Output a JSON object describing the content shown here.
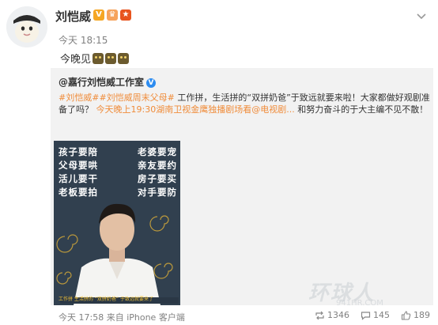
{
  "post": {
    "author": "刘恺威",
    "time": "今天 18:15",
    "text": "今晚见",
    "emoji_icons": [
      "emoji-icon",
      "emoji-icon",
      "emoji-icon"
    ],
    "badge_icons": [
      "verified-icon",
      "level-icon",
      "vip-icon"
    ]
  },
  "repost": {
    "author": "@嘉行刘恺威工作室",
    "tag1": "#刘恺威#",
    "tag2": "#刘恺威周末父母#",
    "text_part1": "工作拼，生活拼的“双拼奶爸”于致远就要来啦！大家都做好观剧准备了吗？",
    "link_text": "今天晚上19:30湖南卫视金鹰独播剧场看@电视剧...",
    "text_part2": "和努力奋斗的于大主编不见不散！",
    "poster_lines": [
      [
        "孩子要陪",
        "老婆要宠"
      ],
      [
        "父母要哄",
        "亲友要约"
      ],
      [
        "活儿要干",
        "房子要买"
      ],
      [
        "老板要拍",
        "对手要防"
      ]
    ],
    "poster_caption": "工作拼  生活拼的  “双拼奶爸”  于致远就要来了"
  },
  "footer": {
    "meta": "今天 17:58 来自 iPhone 客户端",
    "repost_count": "1346",
    "comment_count": "145",
    "like_count": "189"
  },
  "watermark": {
    "main": "环球人",
    "sub": "941HR.COM"
  }
}
